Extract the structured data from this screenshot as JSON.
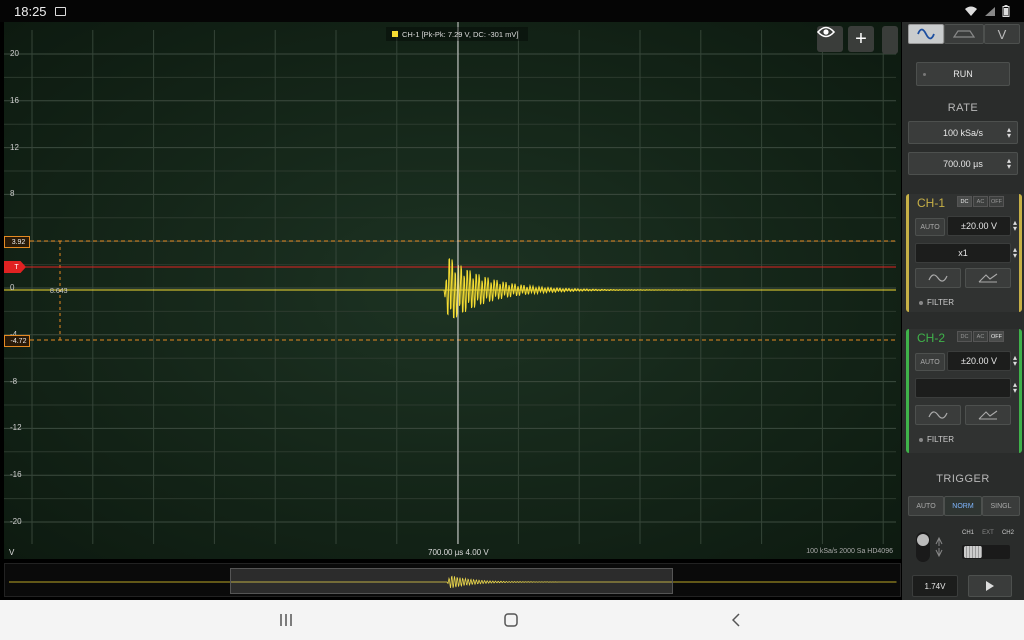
{
  "status": {
    "time": "18:25"
  },
  "scope": {
    "legend": "CH-1 [Pk-Pk: 7.29 V, DC: -301 mV]",
    "y_labels": [
      "20",
      "16",
      "12",
      "8",
      "4",
      "0",
      "-4",
      "-8",
      "-12",
      "-16",
      "-20"
    ],
    "marker_upper": "3.92",
    "marker_trigger": "T",
    "marker_lower": "-4.72",
    "delta_label": "8.643",
    "bottom_center": "700.00 µs  4.00 V",
    "bottom_right": "100 kSa/s   2000 Sa   HD4096",
    "unit": "V"
  },
  "panel": {
    "mode_icons": [
      "sine-wave-icon",
      "math-shape-icon",
      "voltage-v-icon"
    ],
    "mode_v": "V",
    "run": "RUN",
    "rate_title": "RATE",
    "sample_rate": "100 kSa/s",
    "timebase": "700.00 µs",
    "ch1": {
      "label": "CH-1",
      "coupling": [
        "DC",
        "AC",
        "OFF"
      ],
      "auto": "AUTO",
      "range": "±20.00 V",
      "probe": "x1",
      "filter": "FILTER"
    },
    "ch2": {
      "label": "CH-2",
      "coupling": [
        "DC",
        "AC",
        "OFF"
      ],
      "auto": "AUTO",
      "range": "±20.00 V",
      "probe": "",
      "filter": "FILTER"
    },
    "trigger_title": "TRIGGER",
    "trigger_modes": [
      "AUTO",
      "NORM",
      "SINGL"
    ],
    "source_labels": [
      "CH1",
      "EXT",
      "CH2"
    ],
    "trigger_level": "1.74V",
    "colors": {
      "ch1": "#c7b046",
      "ch2": "#3fb24a",
      "trace": "#f4dc32",
      "trigger": "#e02222",
      "cursor": "#e58a22"
    }
  }
}
